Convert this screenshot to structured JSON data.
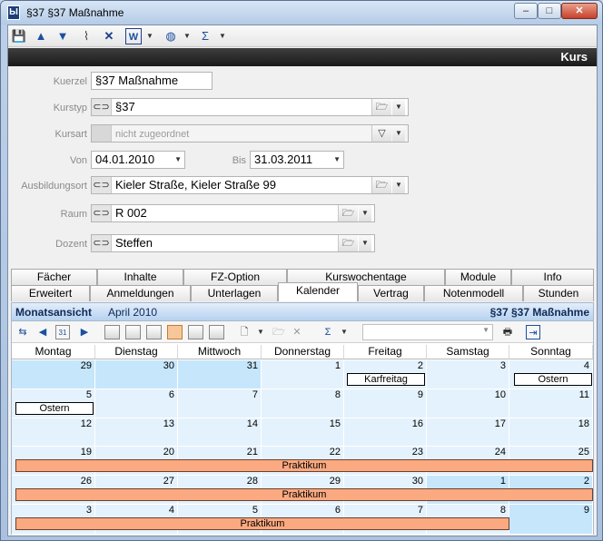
{
  "window": {
    "title": "§37 §37 Maßnahme",
    "app_icon": "app-icon",
    "min": "–",
    "max": "□",
    "close": "✕"
  },
  "toolbar": {
    "icons": [
      "save-icon",
      "arrow-up-icon",
      "arrow-down-icon",
      "paperclip-icon",
      "delete-icon",
      "word-icon",
      "help-icon",
      "sum-icon"
    ]
  },
  "header": {
    "title": "Kurs"
  },
  "form": {
    "kuerzel": {
      "label": "Kuerzel",
      "value": "§37 Maßnahme"
    },
    "kurstyp": {
      "label": "Kurstyp",
      "value": "§37"
    },
    "kursart": {
      "label": "Kursart",
      "value": "nicht zugeordnet"
    },
    "von": {
      "label": "Von",
      "value": "04.01.2010"
    },
    "bis": {
      "label": "Bis",
      "value": "31.03.2011"
    },
    "ausbildungsort": {
      "label": "Ausbildungsort",
      "value": "Kieler Straße, Kieler Straße 99"
    },
    "raum": {
      "label": "Raum",
      "value": "R 002"
    },
    "dozent": {
      "label": "Dozent",
      "value": "Steffen"
    }
  },
  "tabs_row1": [
    "Fächer",
    "Inhalte",
    "FZ-Option",
    "Kurswochentage",
    "Module",
    "Info"
  ],
  "tabs_row2": [
    "Erweitert",
    "Anmeldungen",
    "Unterlagen",
    "Kalender",
    "Vertrag",
    "Notenmodell",
    "Stunden"
  ],
  "active_tab": "Kalender",
  "calendar": {
    "view": "Monatsansicht",
    "month": "April 2010",
    "course": "§37 §37 Maßnahme",
    "days": [
      "Montag",
      "Dienstag",
      "Mittwoch",
      "Donnerstag",
      "Freitag",
      "Samstag",
      "Sonntag"
    ],
    "weeks": [
      [
        "29",
        "30",
        "31",
        "1",
        "2",
        "3",
        "4"
      ],
      [
        "5",
        "6",
        "7",
        "8",
        "9",
        "10",
        "11"
      ],
      [
        "12",
        "13",
        "14",
        "15",
        "16",
        "17",
        "18"
      ],
      [
        "19",
        "20",
        "21",
        "22",
        "23",
        "24",
        "25"
      ],
      [
        "26",
        "27",
        "28",
        "29",
        "30",
        "1",
        "2"
      ],
      [
        "3",
        "4",
        "5",
        "6",
        "7",
        "8",
        "9"
      ]
    ],
    "events": {
      "karfreitag": "Karfreitag",
      "ostern1": "Ostern",
      "ostern2": "Ostern",
      "prak1": "Praktikum",
      "prak2": "Praktikum",
      "prak3": "Praktikum"
    }
  }
}
